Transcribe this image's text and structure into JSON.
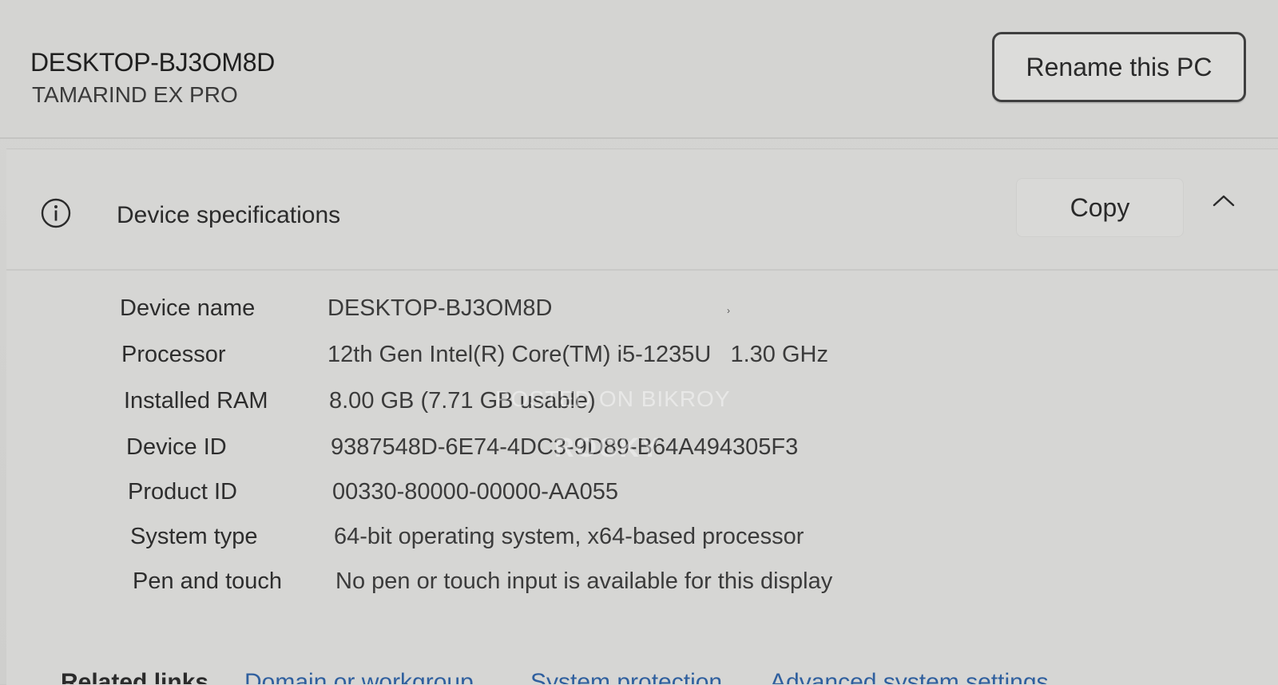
{
  "pc": {
    "name": "DESKTOP-BJ3OM8D",
    "model": "TAMARIND EX PRO",
    "rename_label": "Rename this PC"
  },
  "specs": {
    "title": "Device specifications",
    "copy_label": "Copy",
    "icon": "info-icon",
    "collapse_icon": "chevron-up-icon",
    "rows": [
      {
        "label": "Device name",
        "value": "DESKTOP-BJ3OM8D"
      },
      {
        "label": "Processor",
        "value": "12th Gen Intel(R) Core(TM) i5-1235U   1.30 GHz"
      },
      {
        "label": "Installed RAM",
        "value": "8.00 GB (7.71 GB usable)"
      },
      {
        "label": "Device ID",
        "value": "9387548D-6E74-4DC3-9D89-B64A494305F3"
      },
      {
        "label": "Product ID",
        "value": "00330-80000-00000-AA055"
      },
      {
        "label": "System type",
        "value": "64-bit operating system, x64-based processor"
      },
      {
        "label": "Pen and touch",
        "value": "No pen or touch input is available for this display"
      }
    ]
  },
  "watermark": {
    "line1": "POSTED ON BIKROY",
    "line2": "ROCKY"
  },
  "related": {
    "label": "Related links",
    "links": [
      "Domain or workgroup",
      "System protection",
      "Advanced system settings"
    ]
  },
  "colors": {
    "background": "#d4d4d2",
    "text": "#2b2b2b",
    "link": "#2f5f9e"
  }
}
